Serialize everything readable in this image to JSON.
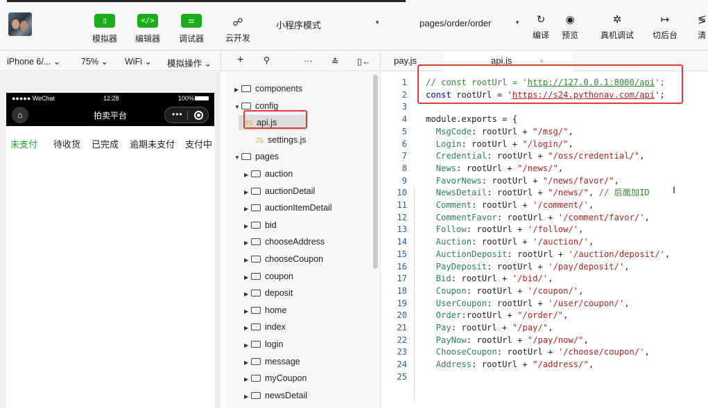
{
  "toolbar": {
    "simulator_label": "模拟器",
    "editor_label": "编辑器",
    "debugger_label": "调试器",
    "cloud_label": "云开发",
    "mode_value": "小程序模式",
    "page_path_value": "pages/order/order",
    "compile_label": "编译",
    "preview_label": "预览",
    "remote_debug_label": "真机调试",
    "background_label": "切后台",
    "clear_label": "清",
    "icons": {
      "simulator": "phone-icon",
      "editor": "code-icon",
      "debugger": "debug-icon",
      "cloud": "cloud-icon",
      "compile": "refresh-icon",
      "preview": "eye-icon",
      "remote_debug": "bug-icon",
      "background": "switch-icon"
    }
  },
  "subbar": {
    "device": "iPhone 6/...",
    "zoom": "75%",
    "network": "WiFi",
    "sim_ops": "模拟操作",
    "tabs": [
      {
        "label": "pay.js"
      },
      {
        "label": "api.js",
        "close": "×"
      }
    ]
  },
  "phone": {
    "carrier": "●●●●● WeChat",
    "time": "12:28",
    "battery": "100%",
    "nav_title": "拍卖平台",
    "order_tabs": [
      "未支付",
      "待收货",
      "已完成",
      "逾期未支付",
      "支付中"
    ],
    "active_tab_color": "#1aad19"
  },
  "filetree": {
    "items": [
      {
        "name": "components",
        "type": "folder",
        "expanded": false,
        "depth": 0
      },
      {
        "name": "config",
        "type": "folder",
        "expanded": true,
        "depth": 0
      },
      {
        "name": "api.js",
        "type": "js",
        "depth": 1,
        "selected": true
      },
      {
        "name": "settings.js",
        "type": "js",
        "depth": 1
      },
      {
        "name": "pages",
        "type": "folder",
        "expanded": true,
        "depth": 0
      },
      {
        "name": "auction",
        "type": "folder",
        "expanded": false,
        "depth": 1
      },
      {
        "name": "auctionDetail",
        "type": "folder",
        "expanded": false,
        "depth": 1
      },
      {
        "name": "auctionItemDetail",
        "type": "folder",
        "expanded": false,
        "depth": 1
      },
      {
        "name": "bid",
        "type": "folder",
        "expanded": false,
        "depth": 1
      },
      {
        "name": "chooseAddress",
        "type": "folder",
        "expanded": false,
        "depth": 1
      },
      {
        "name": "chooseCoupon",
        "type": "folder",
        "expanded": false,
        "depth": 1
      },
      {
        "name": "coupon",
        "type": "folder",
        "expanded": false,
        "depth": 1
      },
      {
        "name": "deposit",
        "type": "folder",
        "expanded": false,
        "depth": 1
      },
      {
        "name": "home",
        "type": "folder",
        "expanded": false,
        "depth": 1
      },
      {
        "name": "index",
        "type": "folder",
        "expanded": false,
        "depth": 1
      },
      {
        "name": "login",
        "type": "folder",
        "expanded": false,
        "depth": 1
      },
      {
        "name": "message",
        "type": "folder",
        "expanded": false,
        "depth": 1
      },
      {
        "name": "myCoupon",
        "type": "folder",
        "expanded": false,
        "depth": 1
      },
      {
        "name": "newsDetail",
        "type": "folder",
        "expanded": false,
        "depth": 1
      }
    ],
    "js_badge": "JS"
  },
  "editor": {
    "lines": [
      {
        "n": "1",
        "parts": [
          [
            "c",
            "// const rootUrl = '"
          ],
          [
            "cu",
            "http://127.0.0.1:8000/api"
          ],
          [
            "c",
            "';"
          ]
        ]
      },
      {
        "n": "2",
        "parts": [
          [
            "k",
            "const"
          ],
          [
            "t",
            " rootUrl = '"
          ],
          [
            "su",
            "https://s24.pythonav.com/api"
          ],
          [
            "t",
            "';"
          ]
        ]
      },
      {
        "n": "3",
        "parts": []
      },
      {
        "n": "4",
        "parts": [
          [
            "t",
            "module.exports = {"
          ]
        ]
      },
      {
        "n": "5",
        "parts": [
          [
            "p",
            "  MsgCode"
          ],
          [
            "t",
            ": rootUrl + "
          ],
          [
            "s",
            "\"/msg/\""
          ],
          [
            "t",
            ","
          ]
        ]
      },
      {
        "n": "6",
        "parts": [
          [
            "p",
            "  Login"
          ],
          [
            "t",
            ": rootUrl + "
          ],
          [
            "s",
            "\"/login/\""
          ],
          [
            "t",
            ","
          ]
        ]
      },
      {
        "n": "7",
        "parts": [
          [
            "p",
            "  Credential"
          ],
          [
            "t",
            ": rootUrl + "
          ],
          [
            "s",
            "\"/oss/credential/\""
          ],
          [
            "t",
            ","
          ]
        ]
      },
      {
        "n": "8",
        "parts": [
          [
            "p",
            "  News"
          ],
          [
            "t",
            ": rootUrl + "
          ],
          [
            "s",
            "\"/news/\""
          ],
          [
            "t",
            ","
          ]
        ]
      },
      {
        "n": "9",
        "parts": [
          [
            "p",
            "  FavorNews"
          ],
          [
            "t",
            ": rootUrl + "
          ],
          [
            "s",
            "\"/news/favor/\""
          ],
          [
            "t",
            ","
          ]
        ]
      },
      {
        "n": "10",
        "parts": [
          [
            "p",
            "  NewsDetail"
          ],
          [
            "t",
            ": rootUrl + "
          ],
          [
            "s",
            "\"/news/\""
          ],
          [
            "t",
            ", "
          ],
          [
            "c",
            "// 后面加ID"
          ]
        ]
      },
      {
        "n": "11",
        "parts": [
          [
            "p",
            "  Comment"
          ],
          [
            "t",
            ": rootUrl + "
          ],
          [
            "s",
            "'/comment/'"
          ],
          [
            "t",
            ","
          ]
        ]
      },
      {
        "n": "12",
        "parts": [
          [
            "p",
            "  CommentFavor"
          ],
          [
            "t",
            ": rootUrl + "
          ],
          [
            "s",
            "'/comment/favor/'"
          ],
          [
            "t",
            ","
          ]
        ]
      },
      {
        "n": "13",
        "parts": [
          [
            "p",
            "  Follow"
          ],
          [
            "t",
            ": rootUrl + "
          ],
          [
            "s",
            "'/follow/'"
          ],
          [
            "t",
            ","
          ]
        ]
      },
      {
        "n": "14",
        "parts": [
          [
            "p",
            "  Auction"
          ],
          [
            "t",
            ": rootUrl + "
          ],
          [
            "s",
            "'/auction/'"
          ],
          [
            "t",
            ","
          ]
        ]
      },
      {
        "n": "15",
        "parts": [
          [
            "p",
            "  AuctionDeposit"
          ],
          [
            "t",
            ": rootUrl + "
          ],
          [
            "s",
            "'/auction/deposit/'"
          ],
          [
            "t",
            ","
          ]
        ]
      },
      {
        "n": "16",
        "parts": [
          [
            "p",
            "  PayDeposit"
          ],
          [
            "t",
            ": rootUrl + "
          ],
          [
            "s",
            "'/pay/deposit/'"
          ],
          [
            "t",
            ","
          ]
        ]
      },
      {
        "n": "17",
        "parts": [
          [
            "p",
            "  Bid"
          ],
          [
            "t",
            ": rootUrl + "
          ],
          [
            "s",
            "'/bid/'"
          ],
          [
            "t",
            ","
          ]
        ]
      },
      {
        "n": "18",
        "parts": [
          [
            "p",
            "  Coupon"
          ],
          [
            "t",
            ": rootUrl + "
          ],
          [
            "s",
            "'/coupon/'"
          ],
          [
            "t",
            ","
          ]
        ]
      },
      {
        "n": "19",
        "parts": [
          [
            "p",
            "  UserCoupon"
          ],
          [
            "t",
            ": rootUrl + "
          ],
          [
            "s",
            "'/user/coupon/'"
          ],
          [
            "t",
            ","
          ]
        ]
      },
      {
        "n": "20",
        "parts": [
          [
            "p",
            "  Order"
          ],
          [
            "t",
            ":rootUrl + "
          ],
          [
            "s",
            "\"/order/\""
          ],
          [
            "t",
            ","
          ]
        ]
      },
      {
        "n": "21",
        "parts": [
          [
            "p",
            "  Pay"
          ],
          [
            "t",
            ": rootUrl + "
          ],
          [
            "s",
            "\"/pay/\""
          ],
          [
            "t",
            ","
          ]
        ]
      },
      {
        "n": "22",
        "parts": [
          [
            "p",
            "  PayNow"
          ],
          [
            "t",
            ": rootUrl + "
          ],
          [
            "s",
            "\"/pay/now/\""
          ],
          [
            "t",
            ","
          ]
        ]
      },
      {
        "n": "23",
        "parts": [
          [
            "p",
            "  ChooseCoupon"
          ],
          [
            "t",
            ": rootUrl + "
          ],
          [
            "s",
            "'/choose/coupon/'"
          ],
          [
            "t",
            ","
          ]
        ]
      },
      {
        "n": "24",
        "parts": [
          [
            "p",
            "  Address"
          ],
          [
            "t",
            ": rootUrl + "
          ],
          [
            "s",
            "\"/address/\""
          ],
          [
            "t",
            ","
          ]
        ]
      },
      {
        "n": "25",
        "parts": []
      }
    ]
  },
  "colors": {
    "accent_green": "#1aad19",
    "highlight_red": "#e53935"
  }
}
